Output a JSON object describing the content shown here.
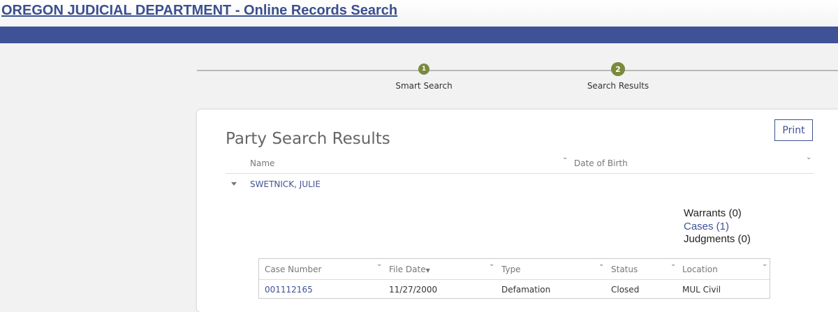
{
  "header": {
    "title": "OREGON JUDICIAL DEPARTMENT - Online Records Search"
  },
  "stepper": {
    "steps": [
      {
        "number": "1",
        "label": "Smart Search"
      },
      {
        "number": "2",
        "label": "Search Results"
      }
    ]
  },
  "results": {
    "title": "Party Search Results",
    "print_label": "Print",
    "columns": [
      "Name",
      "Date of Birth"
    ],
    "party": {
      "name": "SWETNICK, JULIE",
      "dob": "",
      "warrants": "Warrants (0)",
      "cases": "Cases (1)",
      "judgments": "Judgments (0)"
    }
  },
  "cases_table": {
    "headers": [
      "Case Number",
      "File Date",
      "Type",
      "Status",
      "Location"
    ],
    "sort_indicator": "▼",
    "rows": [
      {
        "case_number": "001112165",
        "file_date": "11/27/2000",
        "type": "Defamation",
        "status": "Closed",
        "location": "MUL Civil"
      }
    ]
  },
  "colors": {
    "brand_blue": "#3f5295",
    "step_green": "#7a8a3c"
  },
  "icons": {
    "sort": "chevron-down-icon",
    "expand": "caret-down-icon"
  }
}
